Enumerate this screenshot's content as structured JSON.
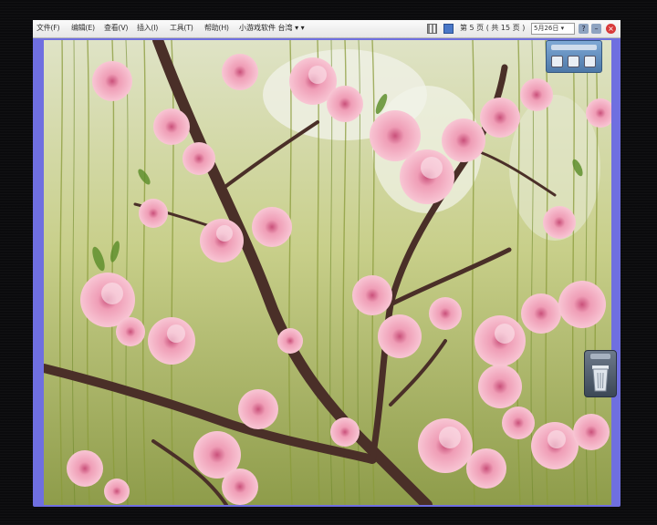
{
  "menubar": {
    "items": [
      "文件(F)",
      "编辑(E)",
      "查看(V)",
      "插入(I)",
      "工具(T)",
      "帮助(H)"
    ],
    "title": "小游戏软件 台湾 ▾ ▾",
    "date_status": "第 5 页 ( 共 15 页 )",
    "date_dropdown": "5月26日 ▾"
  },
  "icons": {
    "toolbar_1": "grid-icon",
    "toolbar_2": "screen-icon",
    "help": "help-icon",
    "minimize": "minimize-icon",
    "close": "close-icon",
    "trash": "trash-icon"
  },
  "colors": {
    "window_frame": "#6f6fe0",
    "close_red": "#d83a3a",
    "blossom": "#f2a9be"
  }
}
